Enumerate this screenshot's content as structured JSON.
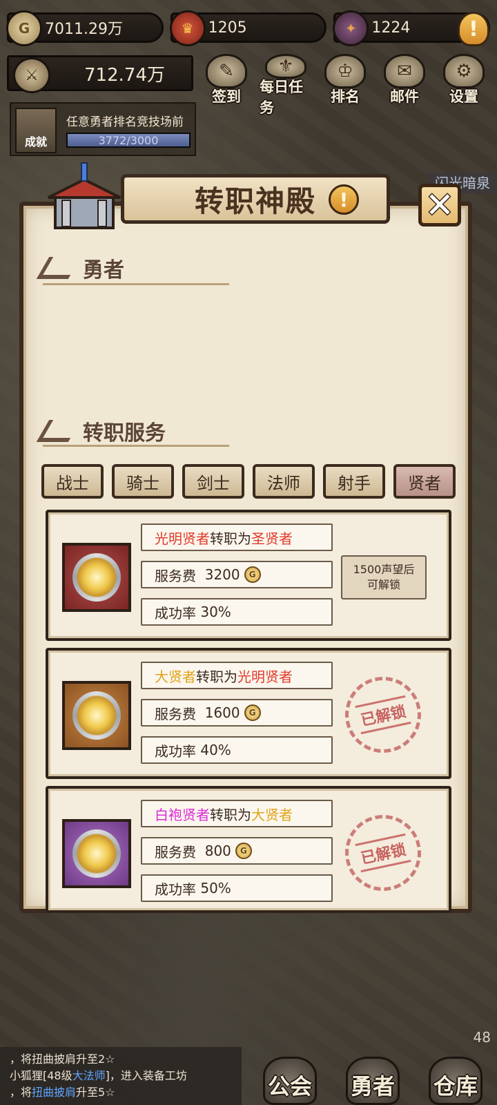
{
  "resources": {
    "gold": "7011.29万",
    "honor": "1205",
    "gems": "1224",
    "power": "712.74万"
  },
  "quick_menu": [
    {
      "label": "签到",
      "icon": "quill-scroll-icon"
    },
    {
      "label": "每日任务",
      "icon": "quest-board-icon"
    },
    {
      "label": "排名",
      "icon": "crown-helmet-icon"
    },
    {
      "label": "邮件",
      "icon": "envelope-icon"
    },
    {
      "label": "设置",
      "icon": "gear-icon"
    }
  ],
  "achievement": {
    "badge_label": "成就",
    "text": "任意勇者排名竞技场前",
    "current": "3772",
    "separator": "/",
    "target": "3000",
    "progress_fraction": 1.0
  },
  "side_tag": "闪光暗泉",
  "panel": {
    "title": "转职神殿",
    "section_hero": "勇者",
    "section_service": "转职服务"
  },
  "tabs": [
    "战士",
    "骑士",
    "剑士",
    "法师",
    "射手",
    "贤者"
  ],
  "active_tab": "贤者",
  "cards": [
    {
      "from": "光明贤者",
      "middle": "转职为",
      "to": "圣贤者",
      "fee_label": "服务费",
      "fee": "3200",
      "rate_label": "成功率",
      "rate": "30%",
      "status": "locked",
      "lock_text_1": "1500声望后",
      "lock_text_2": "可解锁"
    },
    {
      "from": "大贤者",
      "middle": "转职为",
      "to": "光明贤者",
      "fee_label": "服务费",
      "fee": "1600",
      "rate_label": "成功率",
      "rate": "40%",
      "status": "unlocked",
      "stamp": "已解锁"
    },
    {
      "from": "白袍贤者",
      "middle": "转职为",
      "to": "大贤者",
      "fee_label": "服务费",
      "fee": "800",
      "rate_label": "成功率",
      "rate": "50%",
      "status": "unlocked",
      "stamp": "已解锁"
    }
  ],
  "chat": {
    "line1": "，将扭曲披肩升至2☆",
    "line2_prefix": "小狐狸[48级",
    "line2_class": "大法师",
    "line2_suffix": "]，进入装备工坊",
    "line3_prefix": "，将",
    "line3_item": "扭曲披肩",
    "line3_suffix": "升至5☆"
  },
  "bottom_nav": [
    {
      "label": "公会",
      "icon": "guild-castle-icon"
    },
    {
      "label": "勇者",
      "icon": "knight-helmet-icon"
    },
    {
      "label": "仓库",
      "icon": "warehouse-icon",
      "count": "48"
    }
  ],
  "colors": {
    "panel_bg": "#f1e8d3",
    "border": "#3b2a1e",
    "from_red": "#e23a2a",
    "from_gold": "#e1a217",
    "from_pink": "#dc2ad7"
  }
}
